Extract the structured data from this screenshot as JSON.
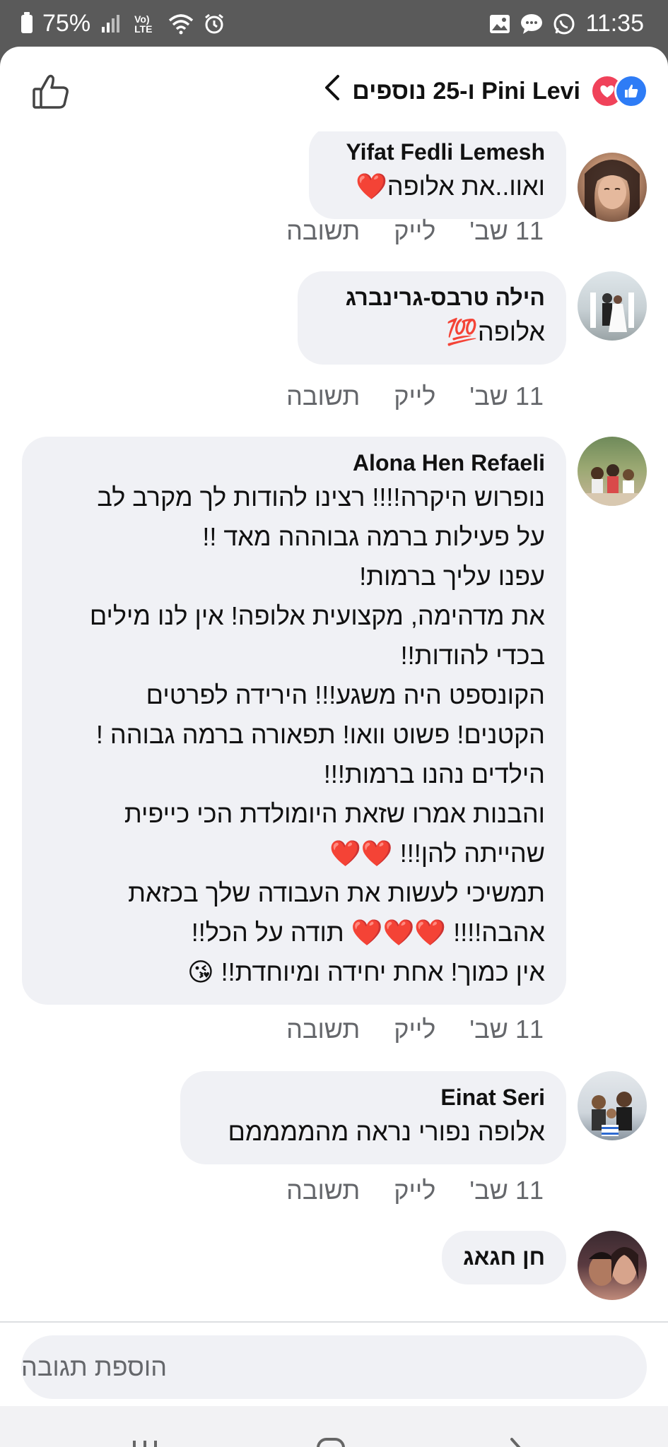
{
  "status_bar": {
    "battery": "75%",
    "signal_label": "Vo) LTE",
    "time": "11:35"
  },
  "header": {
    "title": "Pini Levi ו-25 נוספים",
    "reactions": [
      "like-icon",
      "love-icon"
    ]
  },
  "comments": [
    {
      "author": "Yifat Fedli Lemesh",
      "text": "ואוו..את אלופה❤️",
      "time": "11 שב'",
      "like_label": "לייק",
      "reply_label": "תשובה"
    },
    {
      "author": "הילה טרבס-גרינברג",
      "text": "אלופה💯",
      "time": "11 שב'",
      "like_label": "לייק",
      "reply_label": "תשובה"
    },
    {
      "author": "Alona Hen Refaeli",
      "text": "נופרוש היקרה!!!! רצינו להודות לך מקרב לב\nעל פעילות ברמה גבוההה מאד !!\n עפנו עליך ברמות!\nאת מדהימה, מקצועית אלופה! אין לנו מילים\nבכדי להודות!!\nהקונספט היה משגע!!! הירידה לפרטים\nהקטנים!  פשוט וואו! תפאורה ברמה גבוהה !\nהילדים נהנו ברמות!!!\nוהבנות אמרו שזאת היומולדת הכי כייפית\nשהייתה להן!!! ❤️❤️\nתמשיכי לעשות את העבודה שלך בכזאת\nאהבה!!!! ❤️❤️❤️ תודה על הכל!!\nאין כמוך! אחת יחידה ומיוחדת!! 😘",
      "time": "11 שב'",
      "like_label": "לייק",
      "reply_label": "תשובה"
    },
    {
      "author": "Einat Seri",
      "text": "אלופה נפורי נראה מהממממם",
      "time": "11 שב'",
      "like_label": "לייק",
      "reply_label": "תשובה"
    },
    {
      "author": "חן חגאג",
      "text": ""
    }
  ],
  "composer": {
    "placeholder": "הוספת תגובה"
  },
  "nav": {
    "buttons": [
      "recent-apps-icon",
      "home-icon",
      "back-icon"
    ]
  }
}
